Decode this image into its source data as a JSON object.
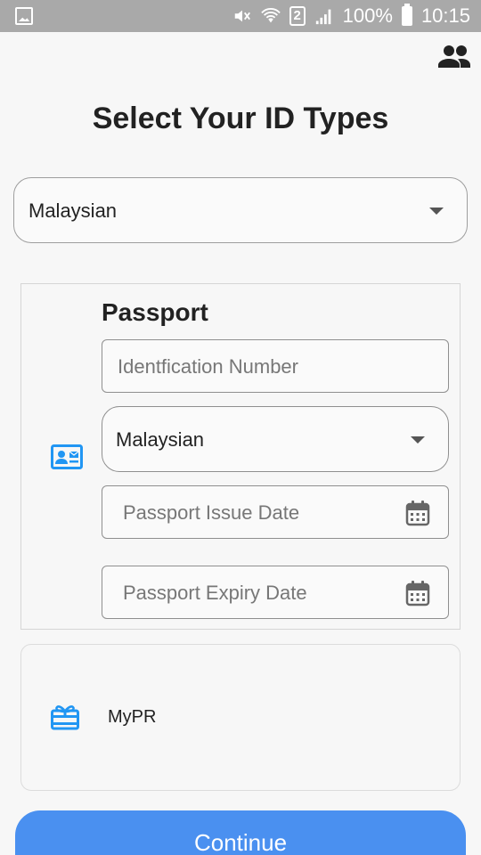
{
  "status_bar": {
    "battery": "100%",
    "time": "10:15",
    "sim_slot": "2",
    "icons": [
      "gallery-notification-icon",
      "mute-icon",
      "wifi-icon",
      "sim-icon",
      "signal-icon",
      "battery-icon"
    ]
  },
  "header": {
    "title": "Select Your ID Types",
    "account_icon": "people-icon"
  },
  "nationality_select": {
    "value": "Malaysian"
  },
  "passport": {
    "title": "Passport",
    "icon": "id-card-icon",
    "id_number_placeholder": "Identfication Number",
    "nationality_value": "Malaysian",
    "issue_date_placeholder": "Passport Issue Date",
    "expiry_date_placeholder": "Passport Expiry Date"
  },
  "mypr": {
    "label": "MyPR",
    "icon": "gift-card-icon"
  },
  "actions": {
    "continue_label": "Continue"
  },
  "colors": {
    "accent": "#4a90f0",
    "icon_blue": "#2196f3",
    "status_bar": "#a9a9a9"
  }
}
